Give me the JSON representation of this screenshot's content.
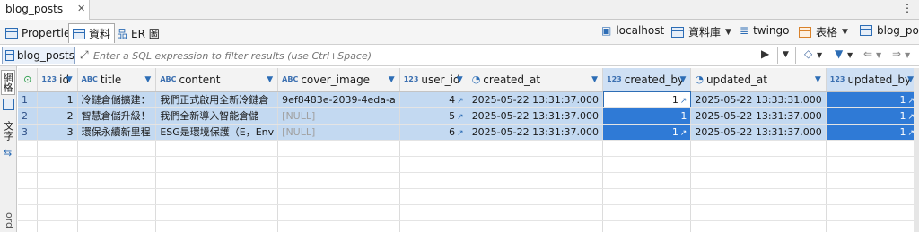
{
  "editor_tab": {
    "title": "blog_posts",
    "close": "✕"
  },
  "view_tabs": [
    {
      "label": "Properties"
    },
    {
      "label": "資料"
    },
    {
      "label": "ER 圖"
    }
  ],
  "context": {
    "connection": "localhost",
    "database_label": "資料庫",
    "database": "twingo",
    "table_kind": "表格",
    "table": "blog_pos"
  },
  "filter": {
    "table_chip": "blog_posts",
    "placeholder": "Enter a SQL expression to filter results (use Ctrl+Space)"
  },
  "side_strip": {
    "grid_label": "網格",
    "text_label": "文字",
    "record_label": "ord"
  },
  "grid": {
    "columns": [
      {
        "name": "id",
        "type": "123"
      },
      {
        "name": "title",
        "type": "ABC"
      },
      {
        "name": "content",
        "type": "ABC"
      },
      {
        "name": "cover_image",
        "type": "ABC"
      },
      {
        "name": "user_id",
        "type": "123"
      },
      {
        "name": "created_at",
        "type": ""
      },
      {
        "name": "created_by",
        "type": "123"
      },
      {
        "name": "updated_at",
        "type": ""
      },
      {
        "name": "updated_by",
        "type": "123"
      }
    ],
    "rows": [
      {
        "rownum": "1",
        "id": "1",
        "title": "冷鏈倉儲擴建：",
        "content": "我們正式啟用全新冷鏈倉",
        "cover_image": "9ef8483e-2039-4eda-a",
        "user_id": "4",
        "created_at": "2025-05-22 13:31:37.000",
        "created_by": "1",
        "updated_at": "2025-05-22 13:33:31.000",
        "updated_by": "1"
      },
      {
        "rownum": "2",
        "id": "2",
        "title": "智慧倉儲升級！",
        "content": "我們全新導入智能倉儲",
        "cover_image": "[NULL]",
        "user_id": "5",
        "created_at": "2025-05-22 13:31:37.000",
        "created_by": "1",
        "updated_at": "2025-05-22 13:31:37.000",
        "updated_by": "1"
      },
      {
        "rownum": "3",
        "id": "3",
        "title": "環保永續新里程",
        "content": "ESG是環境保護（E，Env",
        "cover_image": "[NULL]",
        "user_id": "6",
        "created_at": "2025-05-22 13:31:37.000",
        "created_by": "1",
        "updated_at": "2025-05-22 13:31:37.000",
        "updated_by": "1"
      }
    ]
  }
}
